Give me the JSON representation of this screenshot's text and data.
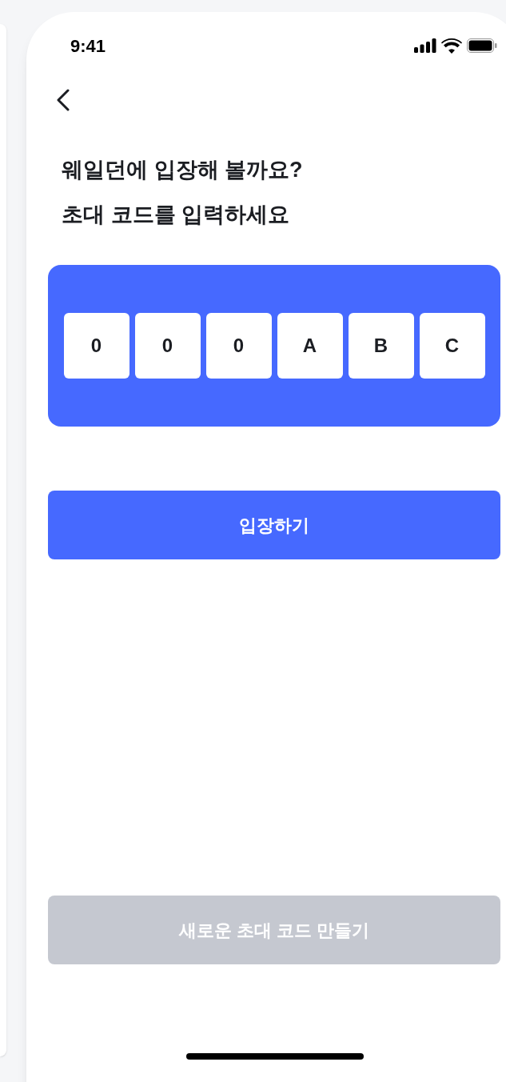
{
  "status_bar": {
    "time": "9:41"
  },
  "title_lines": [
    "웨일던에 입장해 볼까요?",
    "초대 코드를 입력하세요"
  ],
  "code_boxes": [
    {
      "value": "0"
    },
    {
      "value": "0"
    },
    {
      "value": "0"
    },
    {
      "value": "A"
    },
    {
      "value": "B"
    },
    {
      "value": "C"
    }
  ],
  "enter_button": {
    "label": "입장하기",
    "disabled": false
  },
  "create_button": {
    "label": "새로운 초대 코드 만들기",
    "disabled": true
  }
}
